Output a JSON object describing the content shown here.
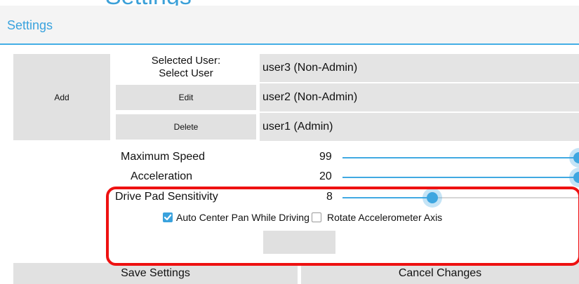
{
  "header": {
    "title": "Settings"
  },
  "users": {
    "add_label": "Add",
    "selected_label": "Selected User:",
    "selected_value": "Select User",
    "edit_label": "Edit",
    "delete_label": "Delete",
    "list": [
      "user3 (Non-Admin)",
      "user2 (Non-Admin)",
      "user1 (Admin)"
    ]
  },
  "sliders": [
    {
      "label": "Maximum Speed",
      "value": "99",
      "fraction": 1.0
    },
    {
      "label": "Acceleration",
      "value": "20",
      "fraction": 1.0
    },
    {
      "label": "Drive Pad Sensitivity",
      "value": "8",
      "fraction": 0.38
    }
  ],
  "options": {
    "auto_center_label": "Auto Center Pan While Driving",
    "auto_center_checked": true,
    "rotate_label": "Rotate Accelerometer Axis",
    "rotate_checked": false
  },
  "actions": {
    "save_label": "Save Settings",
    "cancel_label": "Cancel Changes"
  },
  "colors": {
    "accent": "#3ea6e0",
    "highlight": "#ee1111",
    "button": "#e1e1e1"
  }
}
